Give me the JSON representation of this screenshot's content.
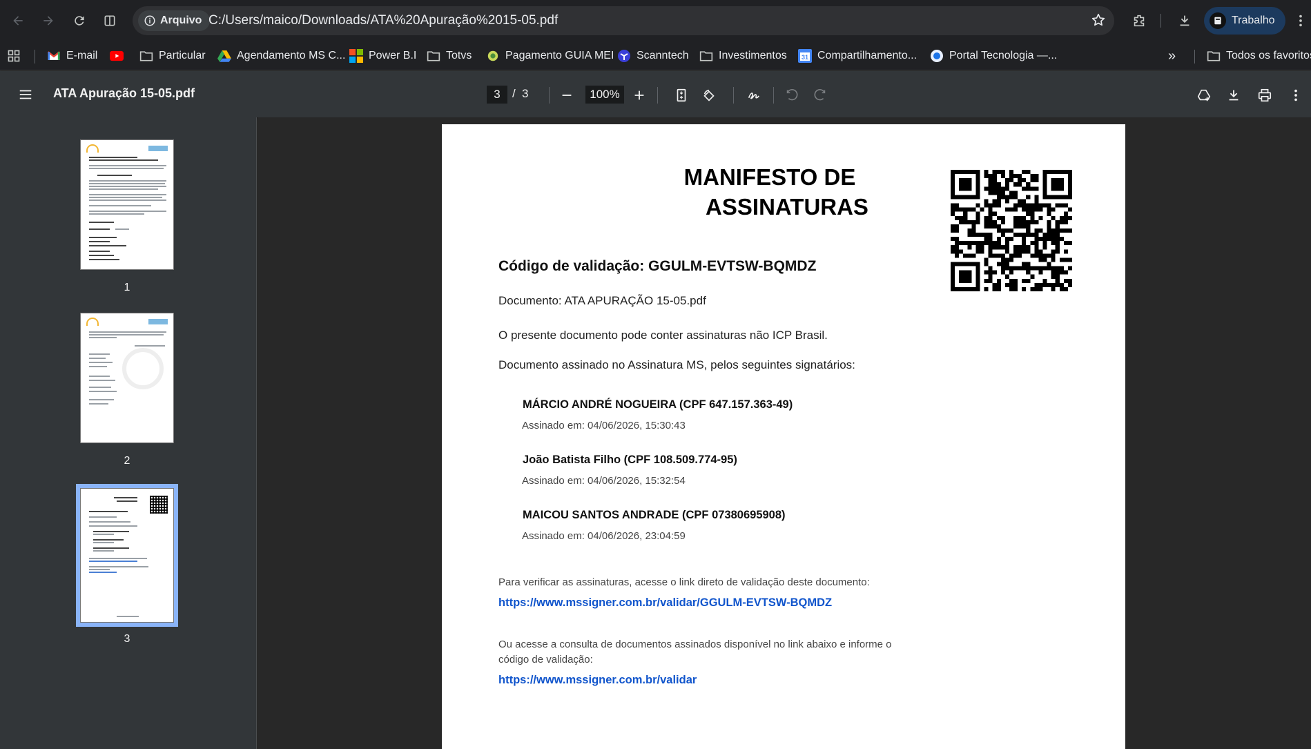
{
  "browser": {
    "site_chip_label": "Arquivo",
    "url": "C:/Users/maico/Downloads/ATA%20Apuração%2015-05.pdf",
    "profile_label": "Trabalho"
  },
  "bookmarks": [
    {
      "label": "E-mail",
      "icon": "gmail-icon"
    },
    {
      "label": "",
      "icon": "youtube-icon"
    },
    {
      "label": "Particular",
      "icon": "folder-icon"
    },
    {
      "label": "Agendamento MS C...",
      "icon": "google-drive-icon"
    },
    {
      "label": "Power B.I",
      "icon": "microsoft-icon"
    },
    {
      "label": "Totvs",
      "icon": "folder-icon"
    },
    {
      "label": "Pagamento GUIA MEI",
      "icon": "gov-icon"
    },
    {
      "label": "Scanntech",
      "icon": "scanntech-icon"
    },
    {
      "label": "Investimentos",
      "icon": "folder-icon"
    },
    {
      "label": "Compartilhamento...",
      "icon": "calendar-icon"
    },
    {
      "label": "Portal Tecnologia —...",
      "icon": "portal-icon"
    }
  ],
  "bookmarks_more_label": "»",
  "all_bookmarks_label": "Todos os favoritos",
  "pdf_toolbar": {
    "title": "ATA Apuração 15-05.pdf",
    "current_page": "3",
    "separator": "/",
    "total_pages": "3",
    "zoom": "100%"
  },
  "thumbnails": [
    {
      "number": "1"
    },
    {
      "number": "2"
    },
    {
      "number": "3"
    }
  ],
  "document": {
    "title_line1": "MANIFESTO DE",
    "title_line2": "ASSINATURAS",
    "validation_code": "Código de validação: GGULM-EVTSW-BQMDZ",
    "document_name": "Documento: ATA APURAÇÃO 15-05.pdf",
    "icp_note": "O presente documento pode conter assinaturas não ICP Brasil.",
    "signed_intro": "Documento assinado no Assinatura MS, pelos seguintes signatários:",
    "signatories": [
      {
        "name": "MÁRCIO ANDRÉ NOGUEIRA (CPF 647.157.363-49)",
        "signed_at": "Assinado em: 04/06/2026, 15:30:43"
      },
      {
        "name": "João Batista Filho (CPF 108.509.774-95)",
        "signed_at": "Assinado em: 04/06/2026, 15:32:54"
      },
      {
        "name": "MAICOU SANTOS ANDRADE (CPF 07380695908)",
        "signed_at": "Assinado em: 04/06/2026, 23:04:59"
      }
    ],
    "verify_text": "Para verificar as assinaturas, acesse o link direto de validação deste documento:",
    "verify_link": "https://www.mssigner.com.br/validar/GGULM-EVTSW-BQMDZ",
    "alt_text": "Ou acesse a consulta de documentos assinados disponível no link abaixo e informe o código de validação:",
    "alt_link": "https://www.mssigner.com.br/validar"
  },
  "colors": {
    "link": "#1155cc",
    "thumb_selected": "#8ab4f8",
    "profile_chip": "#1c3a5e"
  }
}
